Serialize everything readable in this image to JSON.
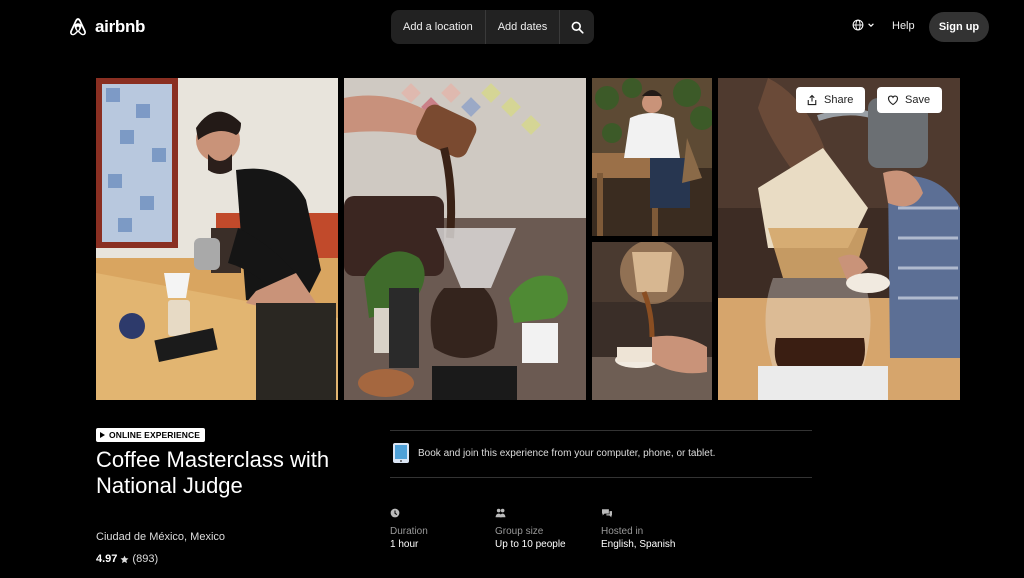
{
  "header": {
    "brand": "airbnb",
    "search": {
      "location": "Add a location",
      "dates": "Add dates"
    },
    "help": "Help",
    "signup": "Sign up"
  },
  "gallery": {
    "share": "Share",
    "save": "Save"
  },
  "experience": {
    "badge": "ONLINE EXPERIENCE",
    "title": "Coffee Masterclass with National Judge",
    "location": "Ciudad de México, Mexico",
    "rating": "4.97",
    "reviews": "(893)",
    "book_text": "Book and join this experience from your computer, phone, or tablet.",
    "stats": [
      {
        "label": "Duration",
        "value": "1 hour",
        "icon": "clock-icon"
      },
      {
        "label": "Group size",
        "value": "Up to 10 people",
        "icon": "people-icon"
      },
      {
        "label": "Hosted in",
        "value": "English, Spanish",
        "icon": "chat-icon"
      }
    ]
  },
  "colors": {
    "background": "#000000",
    "surface": "#222222",
    "button": "#333333",
    "text": "#ffffff"
  }
}
